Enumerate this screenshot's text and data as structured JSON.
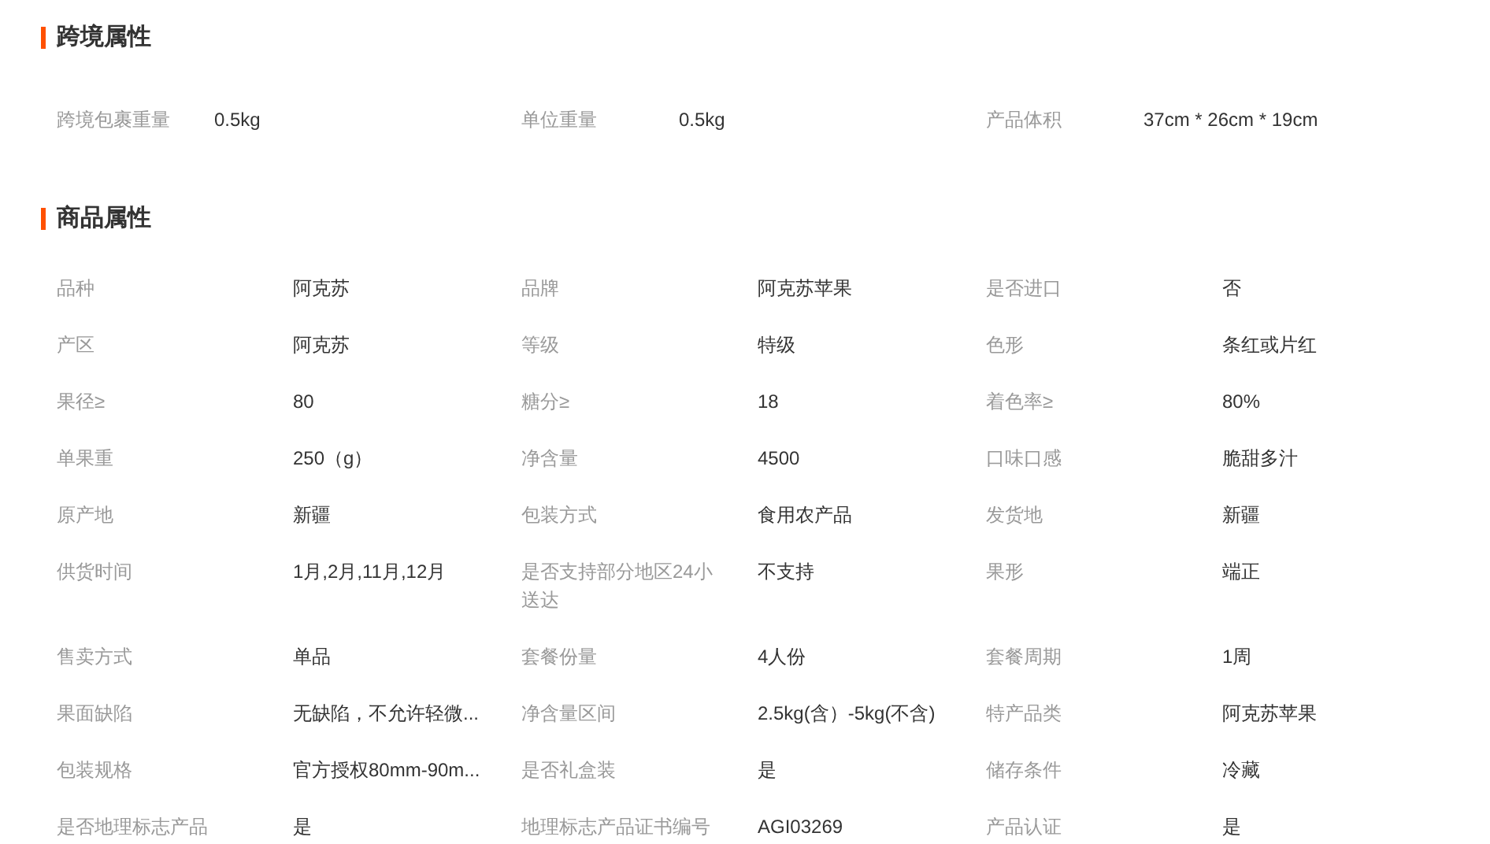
{
  "sections": [
    {
      "title": "跨境属性",
      "kind": "compact",
      "items": [
        {
          "label": "跨境包裹重量",
          "value": "0.5kg"
        },
        {
          "label": "单位重量",
          "value": "0.5kg"
        },
        {
          "label": "产品体积",
          "value": "37cm * 26cm * 19cm"
        }
      ]
    },
    {
      "title": "商品属性",
      "kind": "wide",
      "items": [
        {
          "label": "品种",
          "value": "阿克苏"
        },
        {
          "label": "品牌",
          "value": "阿克苏苹果"
        },
        {
          "label": "是否进口",
          "value": "否"
        },
        {
          "label": "产区",
          "value": "阿克苏"
        },
        {
          "label": "等级",
          "value": "特级"
        },
        {
          "label": "色形",
          "value": "条红或片红"
        },
        {
          "label": "果径≥",
          "value": "80"
        },
        {
          "label": "糖分≥",
          "value": "18"
        },
        {
          "label": "着色率≥",
          "value": "80%"
        },
        {
          "label": "单果重",
          "value": "250（g）"
        },
        {
          "label": "净含量",
          "value": "4500"
        },
        {
          "label": "口味口感",
          "value": "脆甜多汁"
        },
        {
          "label": "原产地",
          "value": "新疆"
        },
        {
          "label": "包装方式",
          "value": "食用农产品"
        },
        {
          "label": "发货地",
          "value": "新疆"
        },
        {
          "label": "供货时间",
          "value": "1月,2月,11月,12月"
        },
        {
          "label": "是否支持部分地区24小送达",
          "value": "不支持"
        },
        {
          "label": "果形",
          "value": "端正"
        },
        {
          "label": "售卖方式",
          "value": "单品"
        },
        {
          "label": "套餐份量",
          "value": "4人份"
        },
        {
          "label": "套餐周期",
          "value": "1周"
        },
        {
          "label": "果面缺陷",
          "value": "无缺陷，不允许轻微..."
        },
        {
          "label": "净含量区间",
          "value": "2.5kg(含）-5kg(不含)"
        },
        {
          "label": "特产品类",
          "value": "阿克苏苹果"
        },
        {
          "label": "包装规格",
          "value": "官方授权80mm-90m..."
        },
        {
          "label": "是否礼盒装",
          "value": "是"
        },
        {
          "label": "储存条件",
          "value": "冷藏"
        },
        {
          "label": "是否地理标志产品",
          "value": "是"
        },
        {
          "label": "地理标志产品证书编号",
          "value": "AGI03269"
        },
        {
          "label": "产品认证",
          "value": "是"
        }
      ]
    }
  ]
}
